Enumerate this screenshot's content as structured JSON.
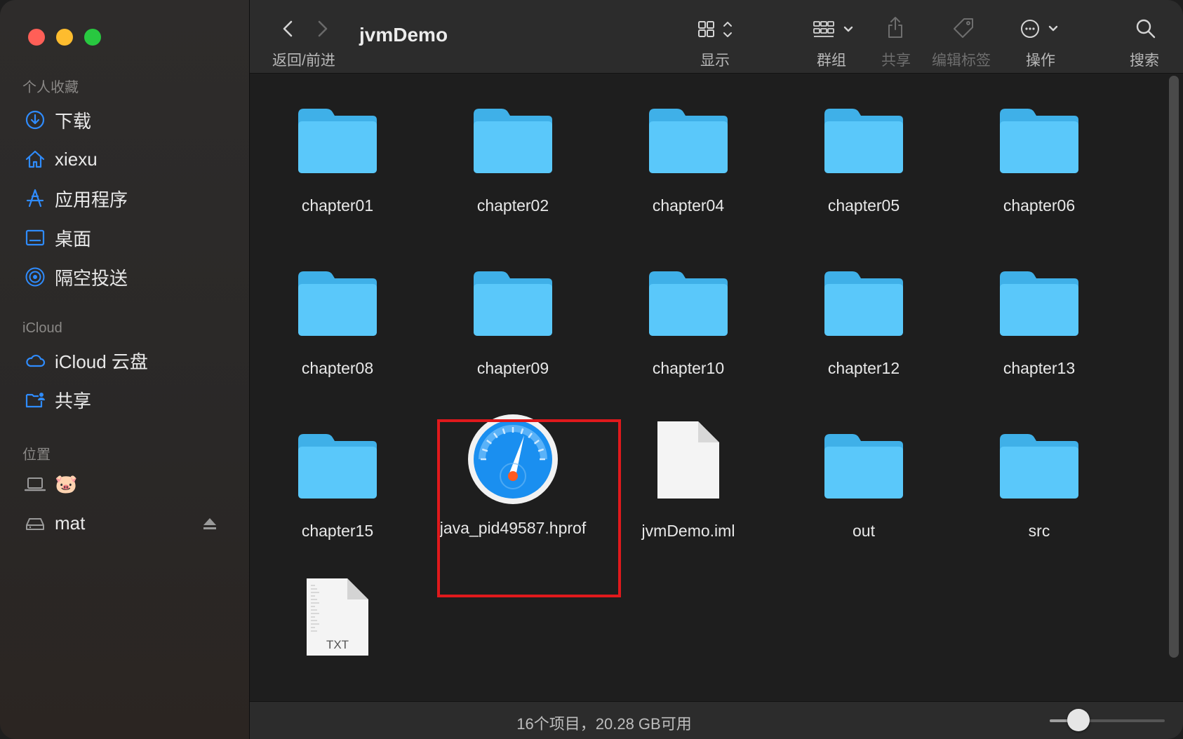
{
  "window": {
    "title": "jvmDemo"
  },
  "sidebar": {
    "favorites_header": "个人收藏",
    "favorites": [
      {
        "label": "下载",
        "icon": "download-icon"
      },
      {
        "label": "xiexu",
        "icon": "home-icon"
      },
      {
        "label": "应用程序",
        "icon": "applications-icon"
      },
      {
        "label": "桌面",
        "icon": "desktop-icon"
      },
      {
        "label": "隔空投送",
        "icon": "airdrop-icon"
      }
    ],
    "icloud_header": "iCloud",
    "icloud": [
      {
        "label": "iCloud 云盘",
        "icon": "cloud-icon"
      },
      {
        "label": "共享",
        "icon": "shared-folder-icon"
      }
    ],
    "locations_header": "位置",
    "locations": [
      {
        "label": "🐷",
        "icon": "laptop-icon"
      },
      {
        "label": "mat",
        "icon": "drive-icon"
      }
    ]
  },
  "toolbar": {
    "nav_label": "返回/前进",
    "view_label": "显示",
    "group_label": "群组",
    "share_label": "共享",
    "tags_label": "编辑标签",
    "action_label": "操作",
    "search_label": "搜索"
  },
  "files": [
    {
      "name": "chapter01",
      "kind": "folder"
    },
    {
      "name": "chapter02",
      "kind": "folder"
    },
    {
      "name": "chapter04",
      "kind": "folder"
    },
    {
      "name": "chapter05",
      "kind": "folder"
    },
    {
      "name": "chapter06",
      "kind": "folder"
    },
    {
      "name": "chapter08",
      "kind": "folder"
    },
    {
      "name": "chapter09",
      "kind": "folder"
    },
    {
      "name": "chapter10",
      "kind": "folder"
    },
    {
      "name": "chapter12",
      "kind": "folder"
    },
    {
      "name": "chapter13",
      "kind": "folder"
    },
    {
      "name": "chapter15",
      "kind": "folder"
    },
    {
      "name": "java_pid49587.hprof",
      "kind": "hprof"
    },
    {
      "name": "jvmDemo.iml",
      "kind": "document"
    },
    {
      "name": "out",
      "kind": "folder"
    },
    {
      "name": "src",
      "kind": "folder"
    },
    {
      "name": "",
      "kind": "txt",
      "badge": "TXT"
    }
  ],
  "status": {
    "text": "16个项目，20.28 GB可用",
    "zoom_level": 0.25
  },
  "colors": {
    "folder": "#5ac8fa",
    "highlight": "#e0191c",
    "accent": "#0a84ff"
  }
}
